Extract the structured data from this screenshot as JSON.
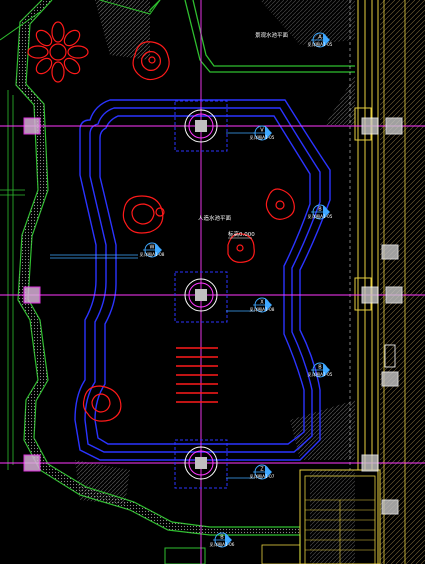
{
  "drawing": {
    "area_label_top": "景观水池平面",
    "area_label_center": "人造水池平面",
    "elevation_label": "标高0.000",
    "callouts": [
      {
        "num": "A",
        "ref": "见详图A1-05"
      },
      {
        "num": "V",
        "ref": "见详图A1-05"
      },
      {
        "num": "B",
        "ref": "见详图A1-05"
      },
      {
        "num": "W",
        "ref": "见详图A1-08"
      },
      {
        "num": "X",
        "ref": "见详图A1-08"
      },
      {
        "num": "B",
        "ref": "见详图A1-05"
      },
      {
        "num": "Z",
        "ref": "见详图A1-07"
      },
      {
        "num": "B",
        "ref": "见详图A1-06"
      }
    ]
  },
  "colors": {
    "background": "#000000",
    "blue_outline": "#2b34ff",
    "magenta_axis": "#ff39ff",
    "red_plant": "#ff1a1a",
    "green_wall": "#2fbf2f",
    "grey_hatch": "#8a8a8a",
    "yellow_wall": "#e8d040",
    "white_text": "#ffffff"
  }
}
